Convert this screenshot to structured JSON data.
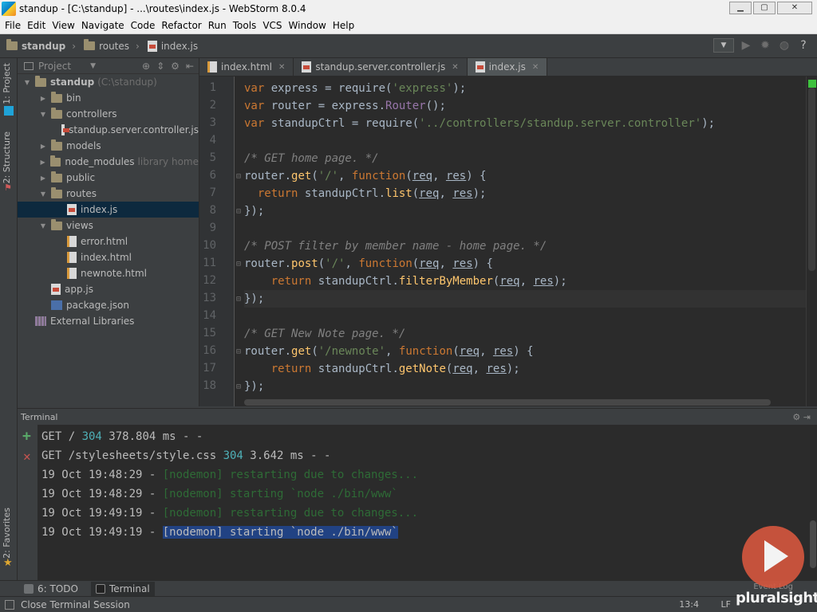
{
  "window": {
    "title": "standup - [C:\\standup] - ...\\routes\\index.js - WebStorm 8.0.4"
  },
  "menu": [
    "File",
    "Edit",
    "View",
    "Navigate",
    "Code",
    "Refactor",
    "Run",
    "Tools",
    "VCS",
    "Window",
    "Help"
  ],
  "breadcrumbs": [
    "standup",
    "routes",
    "index.js"
  ],
  "left_tools": {
    "project": "1: Project",
    "structure": "2: Structure",
    "favorites": "2: Favorites"
  },
  "project_panel": {
    "title": "Project",
    "tree": [
      {
        "label": "standup",
        "extra": "(C:\\standup)",
        "type": "folder",
        "depth": 0,
        "expanded": true
      },
      {
        "label": "bin",
        "type": "folder",
        "depth": 1,
        "expanded": false
      },
      {
        "label": "controllers",
        "type": "folder",
        "depth": 1,
        "expanded": true
      },
      {
        "label": "standup.server.controller.js",
        "type": "js",
        "depth": 2
      },
      {
        "label": "models",
        "type": "folder",
        "depth": 1,
        "expanded": false
      },
      {
        "label": "node_modules",
        "extra": "library home",
        "type": "folder",
        "depth": 1,
        "expanded": false
      },
      {
        "label": "public",
        "type": "folder",
        "depth": 1,
        "expanded": false
      },
      {
        "label": "routes",
        "type": "folder",
        "depth": 1,
        "expanded": true
      },
      {
        "label": "index.js",
        "type": "js",
        "depth": 2,
        "selected": true
      },
      {
        "label": "views",
        "type": "folder",
        "depth": 1,
        "expanded": true
      },
      {
        "label": "error.html",
        "type": "html",
        "depth": 2
      },
      {
        "label": "index.html",
        "type": "html",
        "depth": 2
      },
      {
        "label": "newnote.html",
        "type": "html",
        "depth": 2
      },
      {
        "label": "app.js",
        "type": "js",
        "depth": 1
      },
      {
        "label": "package.json",
        "type": "json",
        "depth": 1
      },
      {
        "label": "External Libraries",
        "type": "lib",
        "depth": 0
      }
    ]
  },
  "editor_tabs": [
    {
      "label": "index.html",
      "type": "html",
      "active": false
    },
    {
      "label": "standup.server.controller.js",
      "type": "js",
      "active": false
    },
    {
      "label": "index.js",
      "type": "js",
      "active": true
    }
  ],
  "code_lines": [
    "var express = require('express');",
    "var router = express.Router();",
    "var standupCtrl = require('../controllers/standup.server.controller');",
    "",
    "/* GET home page. */",
    "router.get('/', function(req, res) {",
    "  return standupCtrl.list(req, res);",
    "});",
    "",
    "/* POST filter by member name - home page. */",
    "router.post('/', function(req, res) {",
    "    return standupCtrl.filterByMember(req, res);",
    "});",
    "",
    "/* GET New Note page. */",
    "router.get('/newnote', function(req, res) {",
    "    return standupCtrl.getNote(req, res);",
    "});"
  ],
  "line_numbers": [
    "1",
    "2",
    "3",
    "4",
    "5",
    "6",
    "7",
    "8",
    "9",
    "10",
    "11",
    "12",
    "13",
    "14",
    "15",
    "16",
    "17",
    "18"
  ],
  "terminal": {
    "title": "Terminal",
    "lines": [
      {
        "pre": "GET / ",
        "num": "304",
        "post": " 378.804 ms - -"
      },
      {
        "pre": "GET /stylesheets/style.css ",
        "num": "304",
        "post": " 3.642 ms - -"
      },
      {
        "pre": "19 Oct 19:48:29 - ",
        "msg": "[nodemon] restarting due to changes..."
      },
      {
        "pre": "19 Oct 19:48:29 - ",
        "msg": "[nodemon] starting `node ./bin/www`"
      },
      {
        "pre": "19 Oct 19:49:19 - ",
        "msg": "[nodemon] restarting due to changes..."
      },
      {
        "pre": "19 Oct 19:49:19 - ",
        "msg": "[nodemon] starting `node ./bin/www`",
        "highlight": true
      }
    ]
  },
  "bottom_tabs": [
    {
      "label": "6: TODO",
      "active": false
    },
    {
      "label": "Terminal",
      "active": true
    }
  ],
  "event_log": "Event Log",
  "status": {
    "message": "Close Terminal Session",
    "position": "13:4",
    "line_ending": "LF"
  },
  "brand": {
    "name": "pluralsight"
  }
}
